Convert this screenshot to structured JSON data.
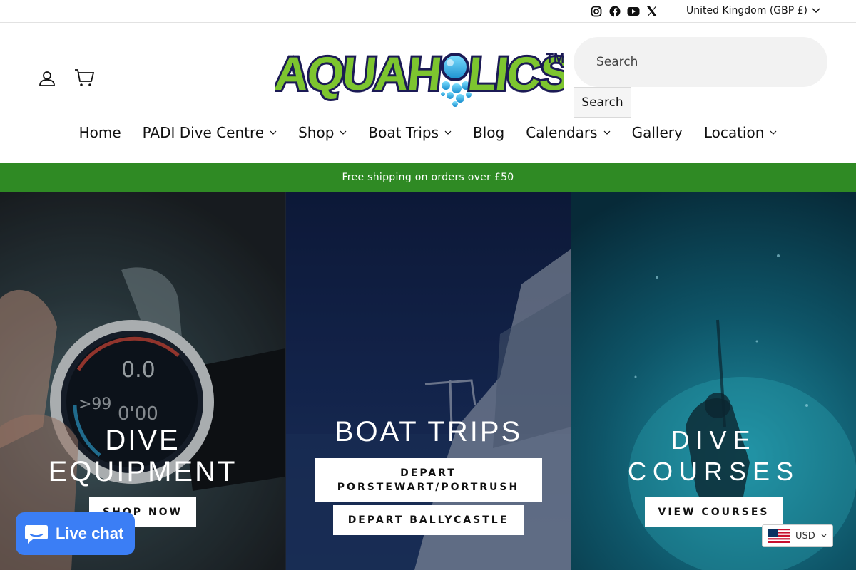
{
  "topbar": {
    "social_icons": [
      "instagram-icon",
      "facebook-icon",
      "youtube-icon",
      "x-icon"
    ],
    "currency_label": "United Kingdom (GBP £)"
  },
  "header": {
    "logo_text": "AQUAHOLICS",
    "logo_mark": "TM",
    "search_placeholder": "Search",
    "search_button": "Search"
  },
  "nav": {
    "items": [
      {
        "label": "Home",
        "dropdown": false
      },
      {
        "label": "PADI Dive Centre",
        "dropdown": true
      },
      {
        "label": "Shop",
        "dropdown": true
      },
      {
        "label": "Boat Trips",
        "dropdown": true
      },
      {
        "label": "Blog",
        "dropdown": false
      },
      {
        "label": "Calendars",
        "dropdown": true
      },
      {
        "label": "Gallery",
        "dropdown": false
      },
      {
        "label": "Location",
        "dropdown": true
      }
    ]
  },
  "announcement": "Free shipping on orders over £50",
  "panels": [
    {
      "title_line1": "DIVE",
      "title_line2": "EQUIPMENT",
      "buttons": [
        "SHOP NOW"
      ]
    },
    {
      "title": "BOAT TRIPS",
      "buttons": [
        "DEPART PORSTEWART/PORTRUSH",
        "DEPART BALLYCASTLE"
      ]
    },
    {
      "title_line1": "DIVE",
      "title_line2": "COURSES",
      "buttons": [
        "VIEW COURSES"
      ]
    }
  ],
  "widgets": {
    "live_chat": "Live chat",
    "currency": "USD"
  },
  "colors": {
    "announcement_bg": "#2f8a24",
    "live_chat_bg": "#3b7ef5",
    "logo_green": "#7dc52f",
    "logo_navy": "#1b1a55",
    "logo_bubble": "#3cc3e8"
  }
}
